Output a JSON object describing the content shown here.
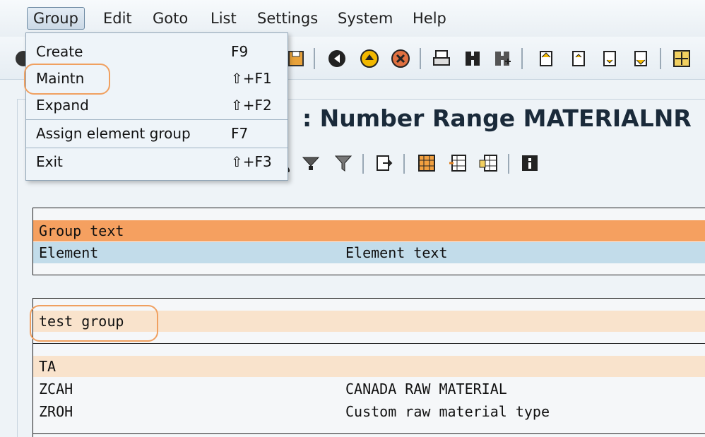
{
  "menubar": {
    "items": [
      "Group",
      "Edit",
      "Goto",
      "List",
      "Settings",
      "System",
      "Help"
    ]
  },
  "dropdown": {
    "items": [
      {
        "label": "Create",
        "shortcut": "F9"
      },
      {
        "label": "Maintn",
        "shortcut": "⇧+F1"
      },
      {
        "label": "Expand",
        "shortcut": "⇧+F2"
      },
      {
        "label": "Assign element group",
        "shortcut": "F7"
      },
      {
        "label": "Exit",
        "shortcut": "⇧+F3"
      }
    ]
  },
  "title": ": Number Range MATERIALNR",
  "header_list": {
    "group_text": "Group text",
    "col1": "Element",
    "col2": "Element text"
  },
  "group_list": {
    "group_name": "test group",
    "subgroup": "TA",
    "rows": [
      {
        "element": "ZCAH",
        "text": "CANADA RAW MATERIAL"
      },
      {
        "element": "ZROH",
        "text": "Custom raw material type"
      }
    ]
  },
  "colors": {
    "group_header": "#f5a060",
    "column_header": "#c2dcea",
    "group_row": "#f9e3cc",
    "highlight": "#f0a060"
  }
}
